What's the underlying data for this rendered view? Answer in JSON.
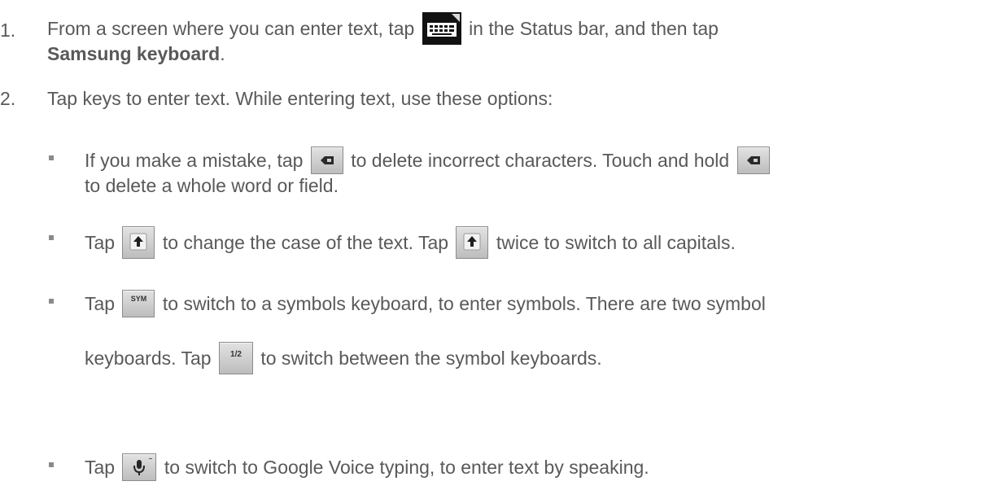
{
  "step1": {
    "number": "1.",
    "text_before": "From a screen where you can enter text, tap",
    "icon": "keyboard-icon",
    "text_after": "in the Status bar, and then tap",
    "bold": "Samsung keyboard",
    "end": "."
  },
  "step2": {
    "number": "2.",
    "text": "Tap keys to enter text. While entering text, use these options:"
  },
  "bullets": [
    {
      "icon": "delete-key-icon",
      "a": "If you make a mistake, tap",
      "b": "to delete incorrect characters. Touch and hold",
      "c": "to delete a whole word or field."
    },
    {
      "icon": "shift-key-icon",
      "a": "Tap",
      "b": "to change the case of the text. Tap",
      "c": "twice to switch to all capitals."
    },
    {
      "icon_sym": "sym-key-icon",
      "icon_half": "symbol-page-key-icon",
      "a": "Tap",
      "b": "to switch to a symbols keyboard, to enter symbols. There are two symbol",
      "c": "keyboards. Tap",
      "d": "to switch between the symbol keyboards."
    },
    {
      "icon": "voice-input-key-icon",
      "a": "Tap",
      "b": "to switch to Google Voice typing, to enter text by speaking."
    }
  ],
  "keys": {
    "sym_label": "SYM",
    "half_label": "1/2"
  }
}
